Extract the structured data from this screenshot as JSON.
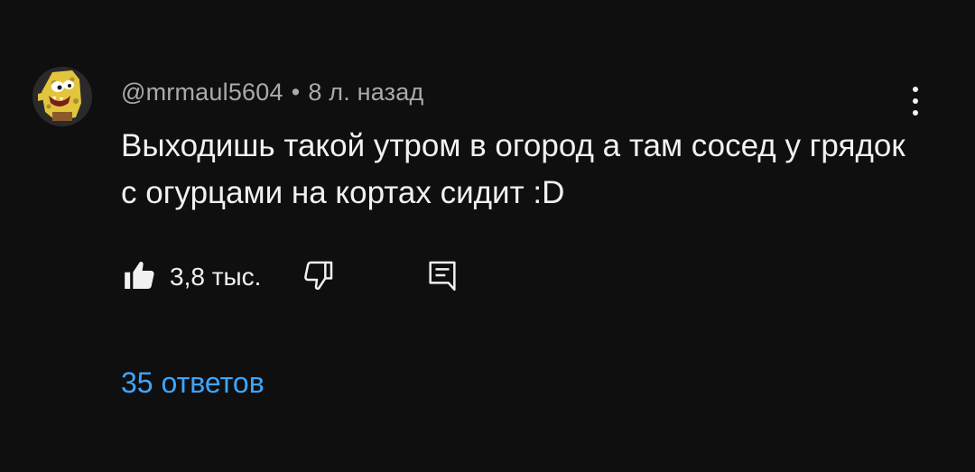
{
  "comment": {
    "author": "@mrmaul5604",
    "separator": "•",
    "time": "8 л. назад",
    "text": "Выходишь такой утром в огород а там сосед у грядок с огурцами на кортах сидит :D",
    "avatar_icon": "caveman-spongebob-avatar"
  },
  "actions": {
    "like_icon": "thumbs-up-icon",
    "like_count": "3,8 тыс.",
    "dislike_icon": "thumbs-down-icon",
    "reply_icon": "reply-comment-icon",
    "menu_icon": "vertical-dots-icon"
  },
  "replies": {
    "label": "35 ответов"
  },
  "colors": {
    "background": "#0f0f0f",
    "text_primary": "#f1f1f1",
    "text_secondary": "#aaaaaa",
    "link": "#3ea6ff"
  }
}
